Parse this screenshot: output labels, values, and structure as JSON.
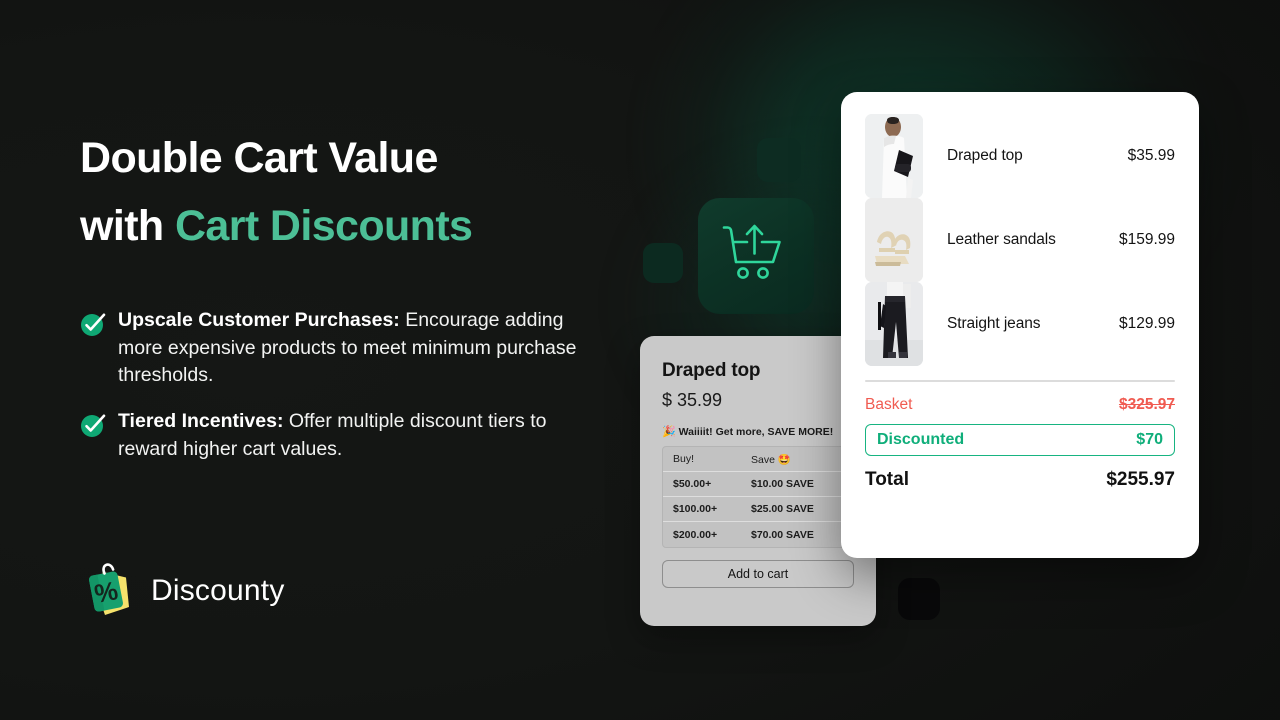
{
  "theme": {
    "background": "#151715",
    "accent_green": "#4cbf96",
    "check_green": "#0fa874",
    "discount_green": "#0fae7a",
    "basket_red": "#f05b51",
    "card_white": "#ffffff",
    "widget_grey": "#c9c9c9"
  },
  "hero": {
    "headline_line1": "Double Cart Value",
    "headline_line2_plain": "with ",
    "headline_line2_accent": "Cart Discounts",
    "bullets": [
      {
        "icon": "check-circle-icon",
        "bold": "Upscale Customer Purchases:",
        "rest": " Encourage adding more expensive products to meet minimum purchase thresholds."
      },
      {
        "icon": "check-circle-icon",
        "bold": "Tiered Incentives:",
        "rest": " Offer multiple discount tiers to reward higher cart values."
      }
    ]
  },
  "brand": {
    "logo_icon": "discount-tag-icon",
    "name": "Discounty"
  },
  "decor": {
    "cart_tile_icon": "cart-upload-icon",
    "squares": [
      "bg-square-top",
      "bg-square-left",
      "bg-square-bottom"
    ]
  },
  "product_widget": {
    "title": "Draped top",
    "price": "$ 35.99",
    "promo_emoji": "🎉",
    "promo_text": "Waiiiit! Get more, SAVE MORE!",
    "table": {
      "headers": [
        "Buy!",
        "Save 🤩"
      ],
      "rows": [
        [
          "$50.00+",
          "$10.00 SAVE"
        ],
        [
          "$100.00+",
          "$25.00 SAVE"
        ],
        [
          "$200.00+",
          "$70.00 SAVE"
        ]
      ]
    },
    "add_to_cart_label": "Add to cart"
  },
  "cart_summary": {
    "items": [
      {
        "thumb": "draped-top-thumbnail",
        "name": "Draped top",
        "price": "$35.99"
      },
      {
        "thumb": "leather-sandals-thumbnail",
        "name": "Leather sandals",
        "price": "$159.99"
      },
      {
        "thumb": "straight-jeans-thumbnail",
        "name": "Straight jeans",
        "price": "$129.99"
      }
    ],
    "basket_label": "Basket",
    "basket_amount": "$325.97",
    "discount_label": "Discounted",
    "discount_amount": "$70",
    "total_label": "Total",
    "total_amount": "$255.97"
  }
}
